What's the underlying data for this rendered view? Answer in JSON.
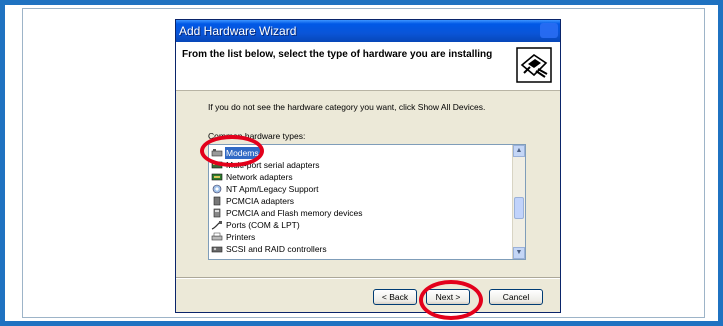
{
  "window": {
    "title": "Add Hardware Wizard"
  },
  "header": {
    "heading": "From the list below, select the type of hardware you are installing"
  },
  "instructions": "If you do not see the hardware category you want, click Show All Devices.",
  "list": {
    "label": "Common hardware types:",
    "items": [
      {
        "label": "Modems",
        "icon": "modem-icon",
        "selected": true
      },
      {
        "label": "Multi-port serial adapters",
        "icon": "serial-adapter-icon",
        "selected": false
      },
      {
        "label": "Network adapters",
        "icon": "network-adapter-icon",
        "selected": false
      },
      {
        "label": "NT Apm/Legacy Support",
        "icon": "legacy-support-icon",
        "selected": false
      },
      {
        "label": "PCMCIA adapters",
        "icon": "pcmcia-icon",
        "selected": false
      },
      {
        "label": "PCMCIA and Flash memory devices",
        "icon": "flash-memory-icon",
        "selected": false
      },
      {
        "label": "Ports (COM & LPT)",
        "icon": "port-icon",
        "selected": false
      },
      {
        "label": "Printers",
        "icon": "printer-icon",
        "selected": false
      },
      {
        "label": "SCSI and RAID controllers",
        "icon": "scsi-icon",
        "selected": false
      }
    ]
  },
  "buttons": {
    "back": "< Back",
    "next": "Next >",
    "cancel": "Cancel"
  },
  "colors": {
    "frame": "#1f72c1",
    "titlebar": "#0a55d8",
    "selection": "#316ac5",
    "annotation": "#e3001b"
  }
}
